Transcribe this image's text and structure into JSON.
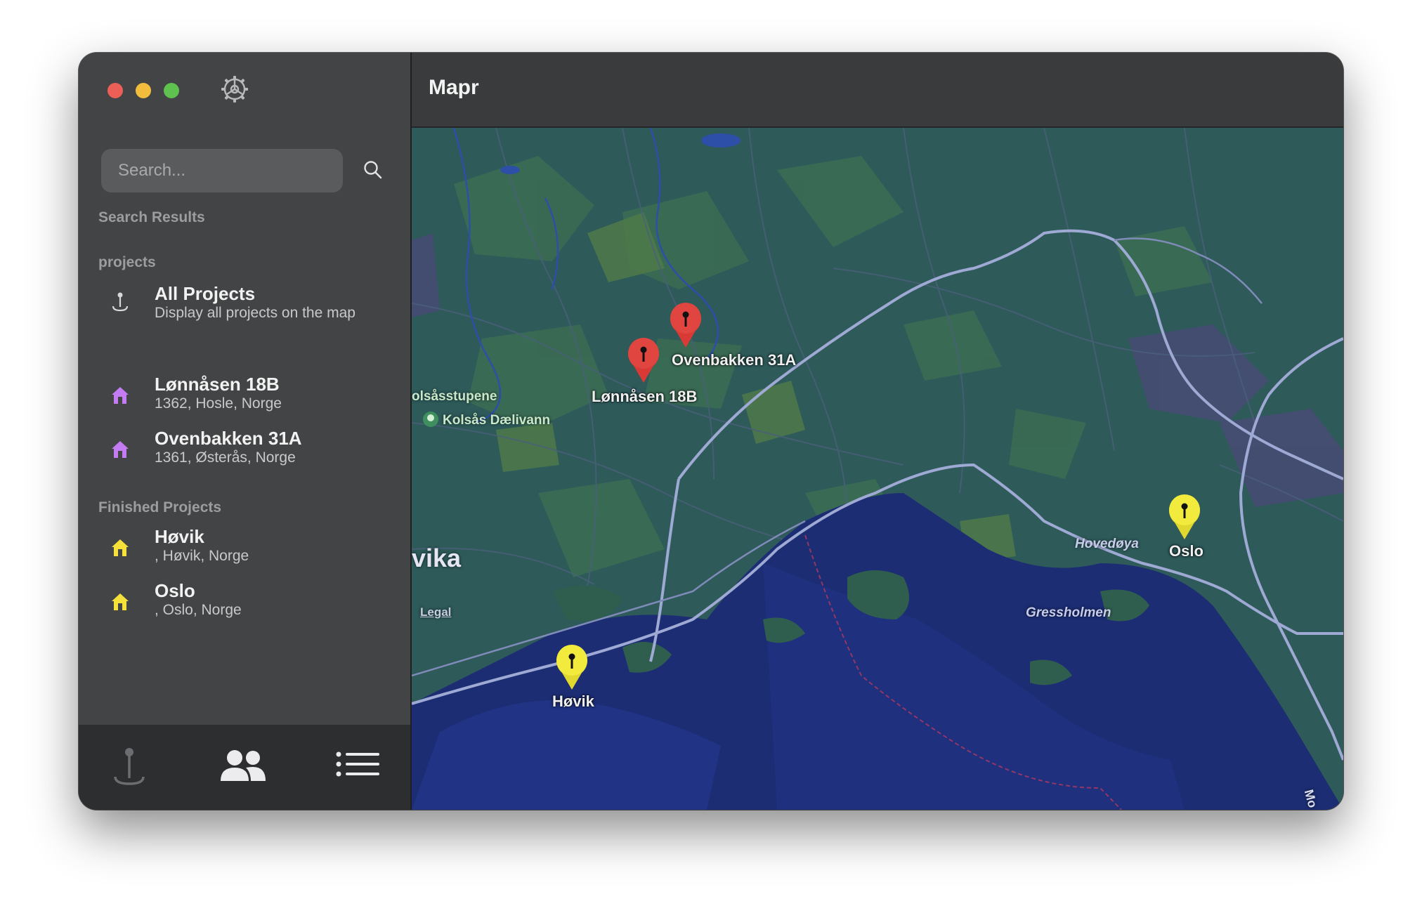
{
  "app": {
    "title": "Mapr"
  },
  "sidebar": {
    "search": {
      "placeholder": "Search..."
    },
    "sections": {
      "search_results": "Search Results",
      "projects": "projects",
      "finished": "Finished Projects"
    },
    "all_projects": {
      "title": "All Projects",
      "subtitle": "Display all projects on the map"
    },
    "projects": [
      {
        "title": "Lønnåsen 18B",
        "subtitle": "1362, Hosle, Norge",
        "icon": "house-icon",
        "color": "#c47cf2"
      },
      {
        "title": "Ovenbakken 31A",
        "subtitle": "1361, Østerås, Norge",
        "icon": "house-icon",
        "color": "#c47cf2"
      }
    ],
    "finished_projects": [
      {
        "title": "Høvik",
        "subtitle": ", Høvik, Norge",
        "icon": "house-icon",
        "color": "#f5e13a"
      },
      {
        "title": "Oslo",
        "subtitle": ", Oslo, Norge",
        "icon": "house-icon",
        "color": "#f5e13a"
      }
    ],
    "bottom_tabs": [
      {
        "name": "map-pin-tab",
        "icon": "pin-icon"
      },
      {
        "name": "people-tab",
        "icon": "people-icon"
      },
      {
        "name": "list-tab",
        "icon": "list-icon"
      }
    ]
  },
  "map": {
    "pins": [
      {
        "label": "Ovenbakken 31A",
        "color": "#d93a35"
      },
      {
        "label": "Lønnåsen 18B",
        "color": "#d93a35"
      },
      {
        "label": "Høvik",
        "color": "#f2ea3c"
      },
      {
        "label": "Oslo",
        "color": "#f2ea3c"
      }
    ],
    "place_labels": {
      "kolsasstupene": "olsåsstupene",
      "kolsas_daelivann": "Kolsås Dælivann",
      "vika": "vika",
      "hovedoya": "Hovedøya",
      "gressholmen": "Gressholmen",
      "mo": "Mo"
    },
    "legal": "Legal"
  },
  "colors": {
    "accent_red": "#d93a35",
    "accent_yellow": "#f2ea3c",
    "project_purple": "#c47cf2"
  }
}
